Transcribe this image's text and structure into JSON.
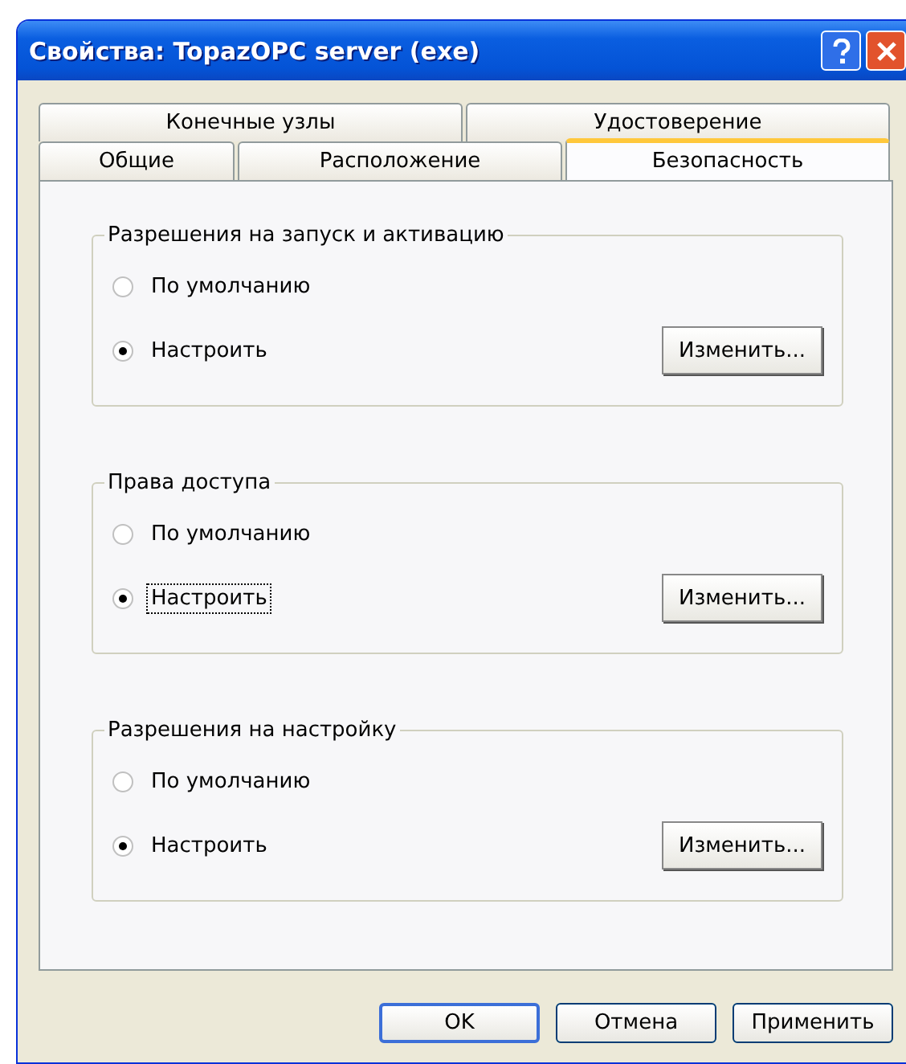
{
  "window": {
    "title": "Свойства: TopazOPC server (exe)"
  },
  "tab_rows": [
    [
      {
        "label": "Конечные узлы",
        "selected": false
      },
      {
        "label": "Удостоверение",
        "selected": false
      }
    ],
    [
      {
        "label": "Общие",
        "selected": false
      },
      {
        "label": "Расположение",
        "selected": false
      },
      {
        "label": "Безопасность",
        "selected": true
      }
    ]
  ],
  "groups": [
    {
      "title": "Разрешения на запуск и активацию",
      "options": [
        {
          "label": "По умолчанию",
          "selected": false,
          "focused": false
        },
        {
          "label": "Настроить",
          "selected": true,
          "focused": false
        }
      ],
      "button": "Изменить..."
    },
    {
      "title": "Права доступа",
      "options": [
        {
          "label": "По умолчанию",
          "selected": false,
          "focused": false
        },
        {
          "label": "Настроить",
          "selected": true,
          "focused": true
        }
      ],
      "button": "Изменить..."
    },
    {
      "title": "Разрешения на настройку",
      "options": [
        {
          "label": "По умолчанию",
          "selected": false,
          "focused": false
        },
        {
          "label": "Настроить",
          "selected": true,
          "focused": false
        }
      ],
      "button": "Изменить..."
    }
  ],
  "buttons": [
    {
      "label": "OK",
      "default": true
    },
    {
      "label": "Отмена",
      "default": false
    },
    {
      "label": "Применить",
      "default": false
    }
  ]
}
